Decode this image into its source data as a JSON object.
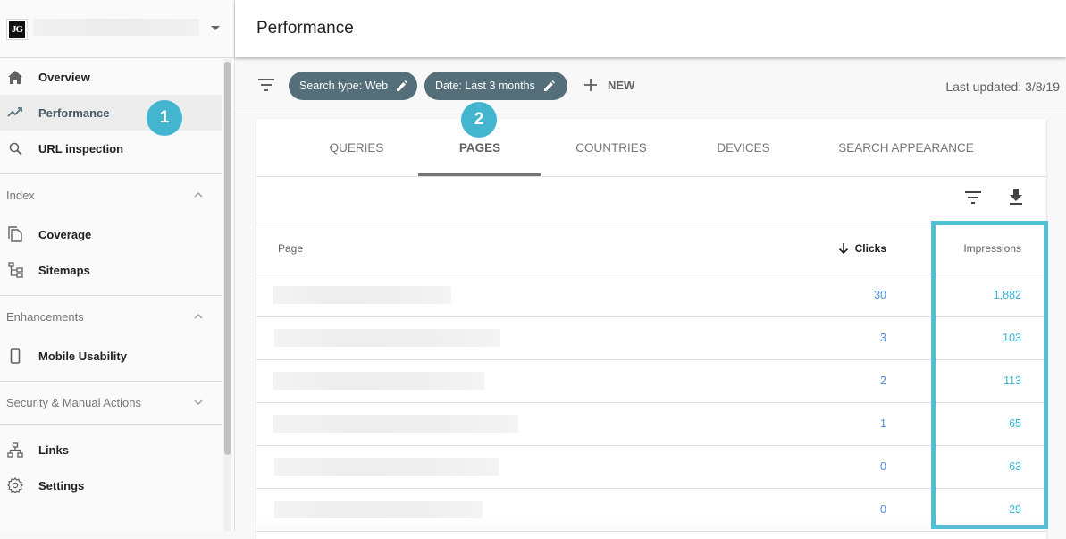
{
  "property": {
    "logo_text": "JG",
    "name_redacted": true
  },
  "sidebar": {
    "top_items": [
      {
        "label": "Overview",
        "icon": "home-icon",
        "active": false
      },
      {
        "label": "Performance",
        "icon": "trending-up-icon",
        "active": true
      },
      {
        "label": "URL inspection",
        "icon": "search-icon",
        "active": false
      }
    ],
    "sections": [
      {
        "label": "Index",
        "expanded": true,
        "items": [
          {
            "label": "Coverage",
            "icon": "coverage-icon"
          },
          {
            "label": "Sitemaps",
            "icon": "sitemap-icon"
          }
        ]
      },
      {
        "label": "Enhancements",
        "expanded": true,
        "items": [
          {
            "label": "Mobile Usability",
            "icon": "phone-icon"
          }
        ]
      },
      {
        "label": "Security & Manual Actions",
        "expanded": false,
        "items": []
      }
    ],
    "bottom_items": [
      {
        "label": "Links",
        "icon": "links-icon"
      },
      {
        "label": "Settings",
        "icon": "gear-icon"
      }
    ]
  },
  "annotations": {
    "badge_1": "1",
    "badge_2": "2",
    "highlight_color": "#52bfd4"
  },
  "header": {
    "title": "Performance"
  },
  "filters": {
    "chips": [
      {
        "label": "Search type: Web"
      },
      {
        "label": "Date: Last 3 months"
      }
    ],
    "new_label": "NEW",
    "last_updated": "Last updated: 3/8/19"
  },
  "tabs": [
    {
      "label": "QUERIES",
      "active": false
    },
    {
      "label": "PAGES",
      "active": true
    },
    {
      "label": "COUNTRIES",
      "active": false
    },
    {
      "label": "DEVICES",
      "active": false
    },
    {
      "label": "SEARCH APPEARANCE",
      "active": false
    }
  ],
  "table": {
    "columns": {
      "page": "Page",
      "clicks": "Clicks",
      "impressions": "Impressions"
    },
    "sort": {
      "column": "clicks",
      "direction": "desc"
    },
    "rows": [
      {
        "page": "",
        "clicks": "30",
        "impressions": "1,882"
      },
      {
        "page": "",
        "clicks": "3",
        "impressions": "103"
      },
      {
        "page": "",
        "clicks": "2",
        "impressions": "113"
      },
      {
        "page": "",
        "clicks": "1",
        "impressions": "65"
      },
      {
        "page": "",
        "clicks": "0",
        "impressions": "63"
      },
      {
        "page": "",
        "clicks": "0",
        "impressions": "29"
      }
    ]
  },
  "colors": {
    "chip_bg": "#546e7a",
    "badge_bg": "#43b5cf",
    "clicks_text": "#4a90e2",
    "impressions_text": "#35b5d0"
  }
}
